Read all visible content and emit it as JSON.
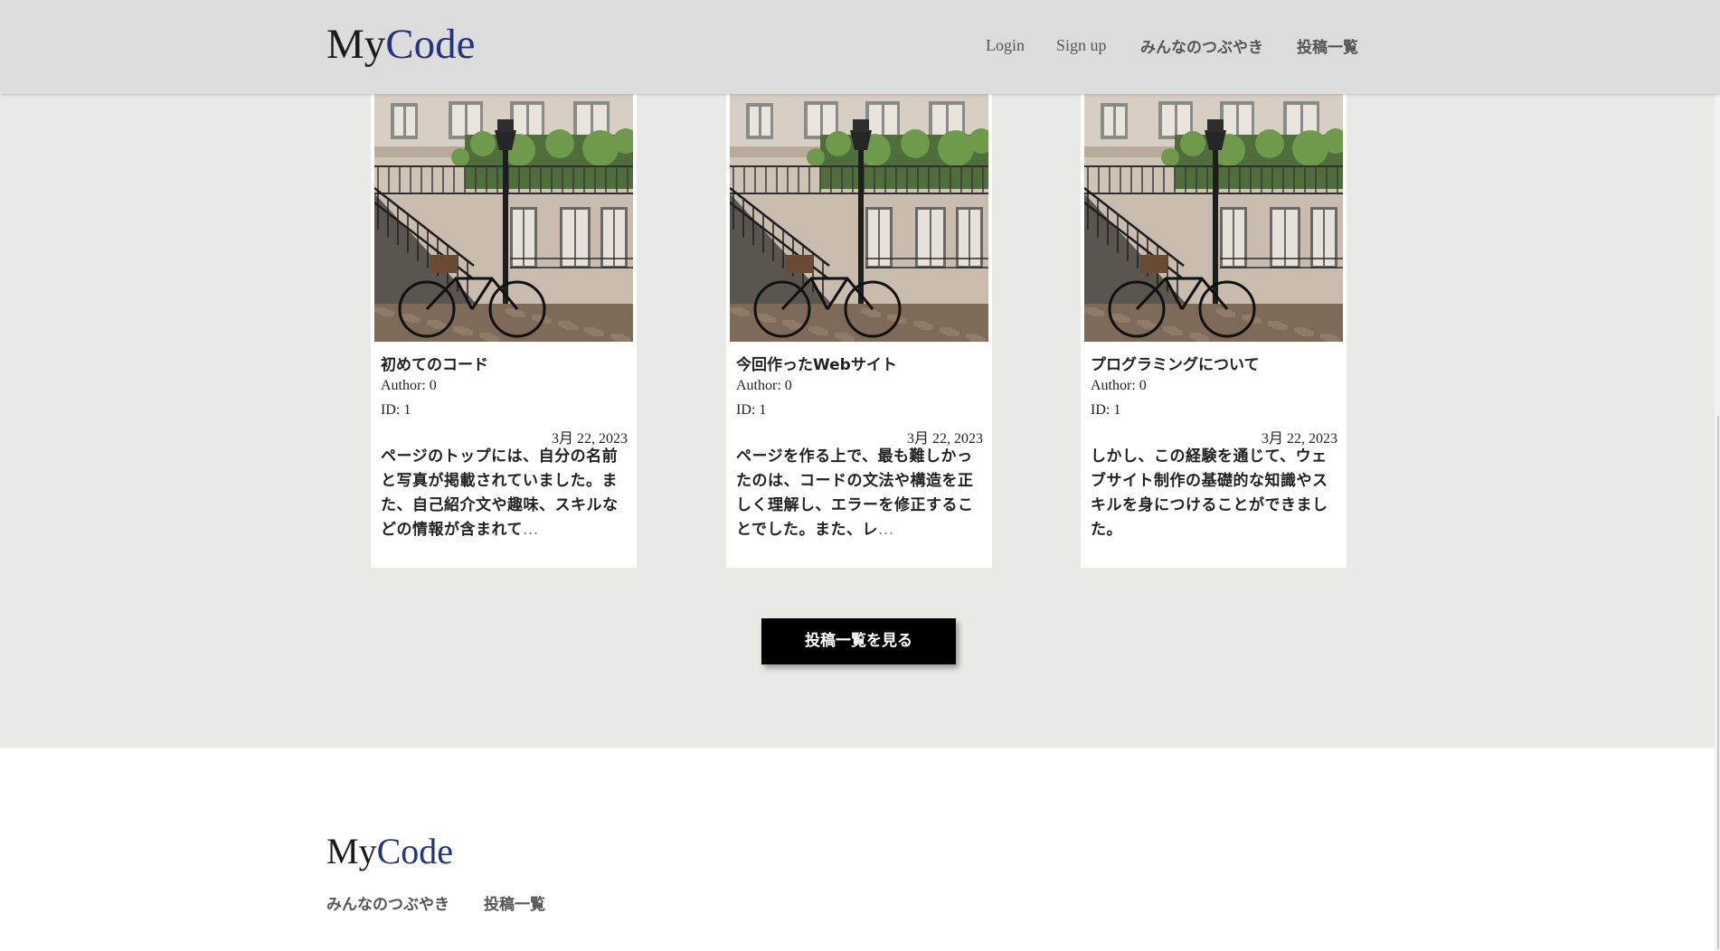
{
  "header": {
    "logo_my": "My",
    "logo_code": "Code",
    "nav": {
      "login": "Login",
      "signup": "Sign up",
      "tsubuyaki": "みんなのつぶやき",
      "posts": "投稿一覧"
    }
  },
  "cards": [
    {
      "title": "初めてのコード",
      "author": "Author: 0",
      "id": "ID: 1",
      "date": "3月 22, 2023",
      "body": "ページのトップには、自分の名前と写真が掲載されていました。また、自己紹介文や趣味、スキルなどの情報が含まれて",
      "ellipsis": "..."
    },
    {
      "title": "今回作ったWebサイト",
      "author": "Author: 0",
      "id": "ID: 1",
      "date": "3月 22, 2023",
      "body": "ページを作る上で、最も難しかったのは、コードの文法や構造を正しく理解し、エラーを修正することでした。また、レ",
      "ellipsis": "..."
    },
    {
      "title": "プログラミングについて",
      "author": "Author: 0",
      "id": "ID: 1",
      "date": "3月 22, 2023",
      "body": "しかし、この経験を通じて、ウェブサイト制作の基礎的な知識やスキルを身につけることができました。",
      "ellipsis": ""
    }
  ],
  "more_button": "投稿一覧を見る",
  "footer": {
    "logo_my": "My",
    "logo_code": "Code",
    "links": {
      "tsubuyaki": "みんなのつぶやき",
      "posts": "投稿一覧"
    }
  },
  "colors": {
    "page_bg": "#e9e9e6",
    "header_bg": "#dcdcdc",
    "logo_accent": "#24347e",
    "button_bg": "#000000"
  }
}
